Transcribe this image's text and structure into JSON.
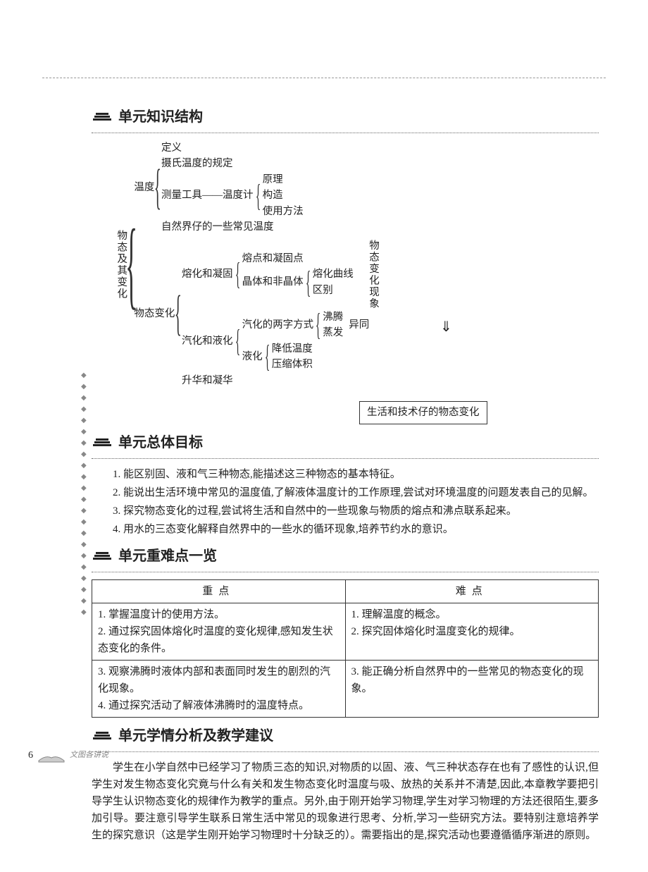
{
  "page_number": "6",
  "footer_label": "文图各讲说",
  "sections": {
    "structure": {
      "title": "单元知识结构"
    },
    "goals": {
      "title": "单元总体目标"
    },
    "difficulty": {
      "title": "单元重难点一览"
    },
    "advice": {
      "title": "单元学情分析及教学建议"
    }
  },
  "diagram": {
    "root": "物态及其变化",
    "temp_label": "温度",
    "temp_items": {
      "def": "定义",
      "celsius": "摄氏温度的规定",
      "tool_prefix": "测量工具——温度计",
      "tool_sub": {
        "a": "原理",
        "b": "构造",
        "c": "使用方法"
      },
      "nature": "自然界仔的一些常见温度"
    },
    "change_label": "物态变化",
    "melt": {
      "label": "熔化和凝固",
      "a": "熔点和凝固点",
      "b_prefix": "晶体和非晶体",
      "b_sub": {
        "x": "熔化曲线",
        "y": "区别"
      }
    },
    "vapor": {
      "label": "汽化和液化",
      "vap_prefix": "汽化的两字方式",
      "vap_sub": {
        "a": "沸腾",
        "b": "蒸发"
      },
      "vap_tail": "异同",
      "liq_prefix": "液化",
      "liq_sub": {
        "a": "降低温度",
        "b": "压缩体积"
      }
    },
    "sublime": "升华和凝华",
    "side_label": "物态变化现象",
    "result": "生活和技术仔的物态变化"
  },
  "goals_list": {
    "g1": "1. 能区别固、液和气三种物态,能描述这三种物态的基本特征。",
    "g2": "2. 能说出生活环境中常见的温度值,了解液体温度计的工作原理,尝试对环境温度的问题发表自己的见解。",
    "g3": "3. 探究物态变化的过程,尝试将生活和自然中的一些现象与物质的熔点和沸点联系起来。",
    "g4": "4. 用水的三态变化解释自然界中的一些水的循环现象,培养节约水的意识。"
  },
  "table": {
    "head_a": "重点",
    "head_b": "难点",
    "a1": "1. 掌握温度计的使用方法。",
    "a2": "2. 通过探究固体熔化时温度的变化规律,感知发生状态变化的条件。",
    "a3": "3. 观察沸腾时液体内部和表面同时发生的剧烈的汽化现象。",
    "a4": "4. 通过探究活动了解液体沸腾时的温度特点。",
    "b1": "1. 理解温度的概念。",
    "b2": "2. 探究固体熔化时温度变化的规律。",
    "b3": "3. 能正确分析自然界中的一些常见的物态变化的现象。"
  },
  "analysis_text": "学生在小学自然中已经学习了物质三态的知识,对物质的以固、液、气三种状态存在也有了感性的认识,但学生对发生物态变化究竟与什么有关和发生物态变化时温度与吸、放热的关系并不清楚,因此,本章教学要把引导学生认识物态变化的规律作为教学的重点。另外,由于刚开始学习物理,学生对学习物理的方法还很陌生,要多加引导。要注意引导学生联系日常生活中常见的现象进行思考、分析,学习一些研究方法。要特别注意培养学生的探究意识（这是学生刚开始学习物理时十分缺乏的）。需要指出的是,探究活动也要遵循循序渐进的原则。"
}
